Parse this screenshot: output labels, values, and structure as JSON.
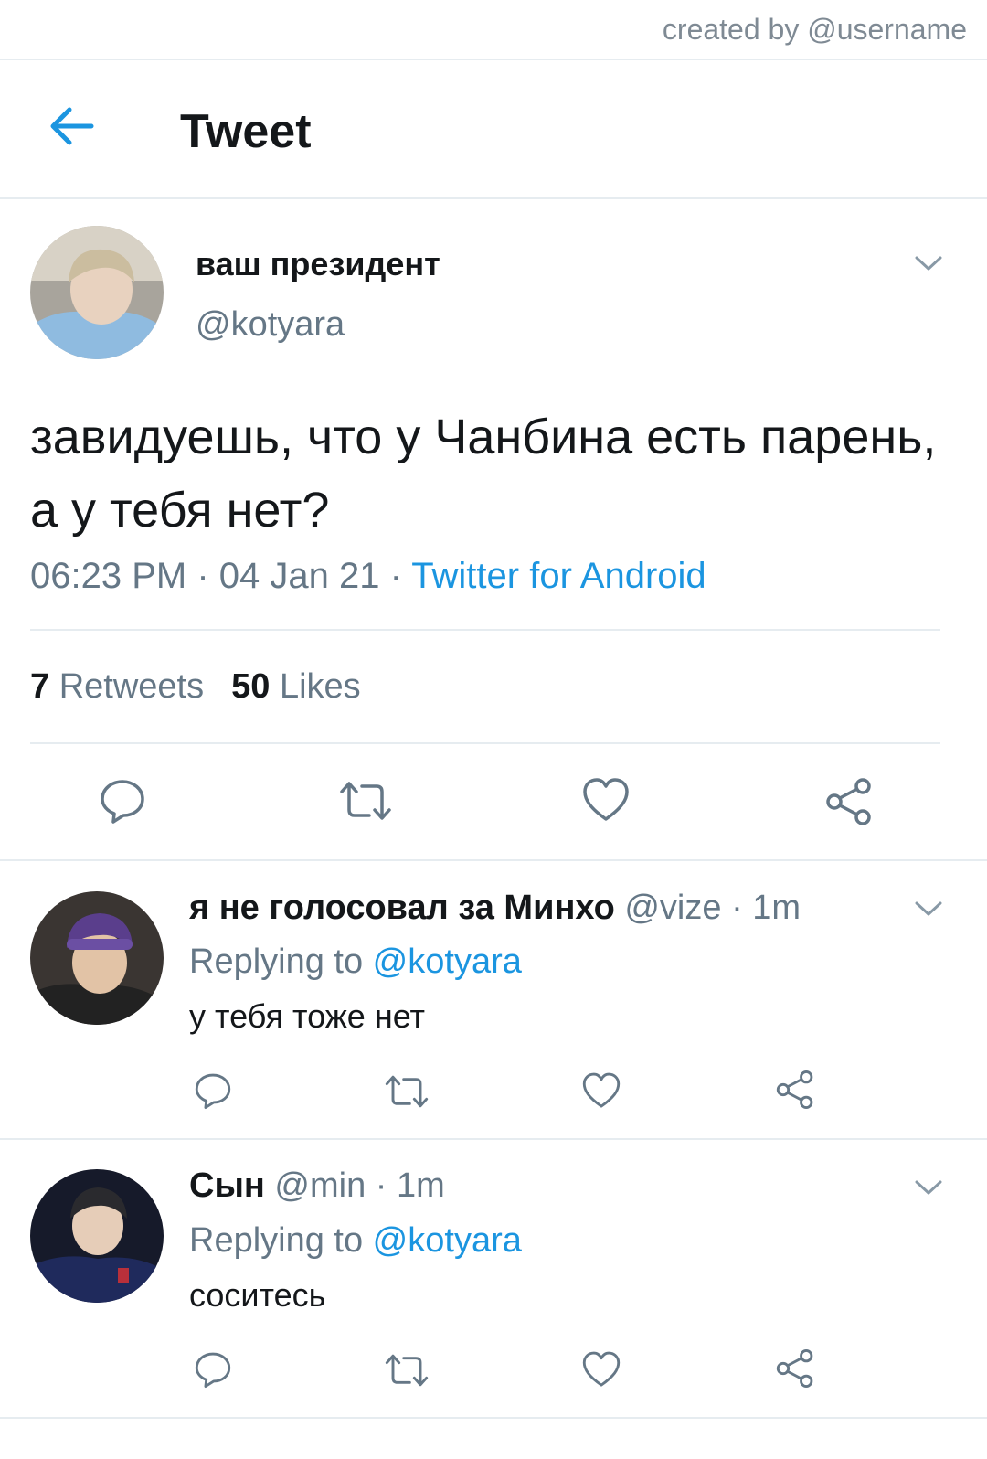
{
  "watermark": "created by @username",
  "header": {
    "title": "Tweet",
    "back_icon": "arrow-left-icon"
  },
  "colors": {
    "accent": "#1b95e0",
    "secondary_text": "#657786",
    "primary_text": "#14171a",
    "divider": "#e6ecf0"
  },
  "tweet": {
    "display_name": "ваш президент",
    "handle": "@kotyara",
    "text": "завидуешь, что у Чанбина есть парень, а у тебя нет?",
    "time": "06:23 PM",
    "sep1": " · ",
    "date": "04 Jan 21",
    "sep2": " · ",
    "source": "Twitter for Android",
    "retweets_count": "7",
    "retweets_label": "Retweets",
    "likes_count": "50",
    "likes_label": "Likes"
  },
  "replies": [
    {
      "display_name": "я не голосовал за Минхо",
      "handle": "@vize",
      "sep": " · ",
      "age": "1m",
      "replying_prefix": "Replying to ",
      "replying_to": "@kotyara",
      "text": "у тебя тоже нет"
    },
    {
      "display_name": "Сын",
      "handle": "@min",
      "sep": " · ",
      "age": "1m",
      "replying_prefix": "Replying to ",
      "replying_to": "@kotyara",
      "text": "соситесь"
    }
  ],
  "icons": {
    "reply": "reply-icon",
    "retweet": "retweet-icon",
    "like": "heart-icon",
    "share": "share-icon",
    "menu": "chevron-down-icon"
  }
}
